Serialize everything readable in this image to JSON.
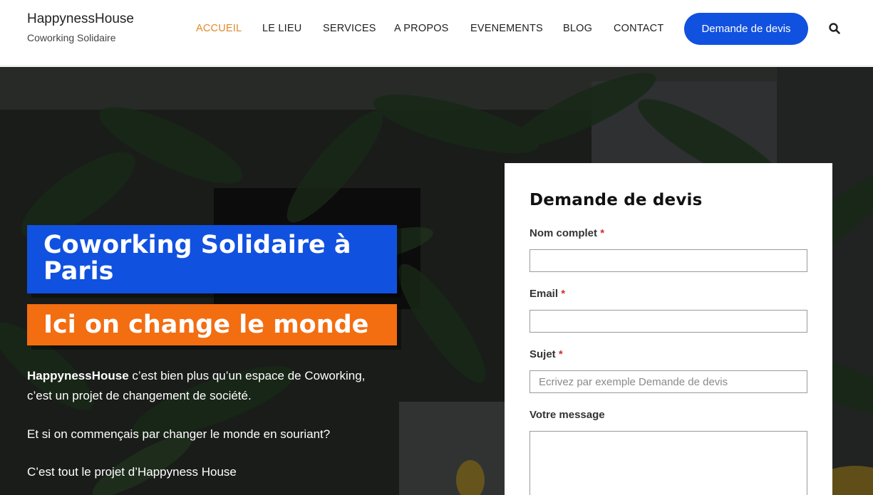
{
  "header": {
    "brand_name": "HappynessHouse",
    "brand_tagline": "Coworking Solidaire",
    "nav": [
      {
        "label": "ACCUEIL",
        "active": true
      },
      {
        "label": "LE LIEU",
        "active": false
      },
      {
        "label": "SERVICES",
        "active": false
      },
      {
        "label": "A PROPOS",
        "active": false
      },
      {
        "label": "EVENEMENTS",
        "active": false
      },
      {
        "label": "BLOG",
        "active": false
      },
      {
        "label": "CONTACT",
        "active": false
      }
    ],
    "cta_label": "Demande de devis",
    "search_icon": "search-icon"
  },
  "hero": {
    "title": "Coworking Solidaire à Paris",
    "subtitle": "Ici on change le monde",
    "intro_bold": "HappynessHouse",
    "intro_rest": " c’est bien plus qu’un espace de Coworking,",
    "intro_line2": "c’est un projet de changement de société.",
    "question": "Et si on commençais par changer le monde en souriant?",
    "closing": "C’est tout le projet d’Happyness House"
  },
  "form": {
    "title": "Demande de devis",
    "required_mark": "*",
    "name_label": "Nom complet",
    "name_value": "",
    "email_label": "Email",
    "email_value": "",
    "subject_label": "Sujet",
    "subject_placeholder": "Ecrivez par exemple Demande de devis",
    "message_label": "Votre message",
    "message_value": ""
  },
  "colors": {
    "accent_blue": "#1151e0",
    "accent_orange": "#f36d11",
    "nav_active": "#e08a2b",
    "required": "#d43030"
  }
}
